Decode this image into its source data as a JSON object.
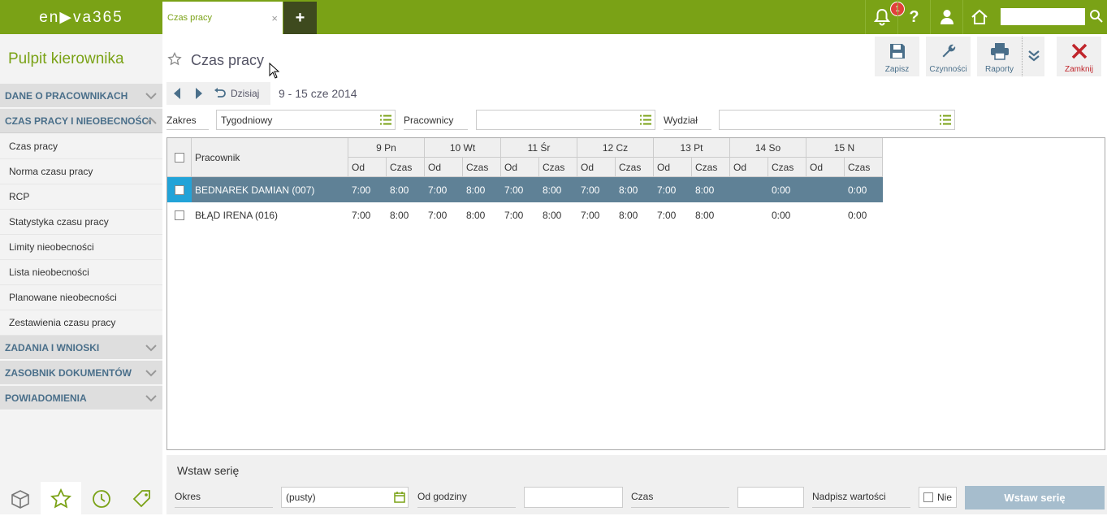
{
  "app": {
    "logo_text": "en▶va365",
    "brand_color": "#7aa216"
  },
  "tabs": [
    {
      "label": "Czas pracy",
      "close": "×"
    }
  ],
  "add_tab_label": "+",
  "notifications": {
    "count": "1"
  },
  "top_search": {
    "value": ""
  },
  "sidebar": {
    "title": "Pulpit kierownika",
    "sections": [
      {
        "label": "DANE O PRACOWNIKACH",
        "expanded": false
      },
      {
        "label": "CZAS PRACY I NIEOBECNOŚCI",
        "expanded": true
      },
      {
        "label": "ZADANIA I WNIOSKI",
        "expanded": false
      },
      {
        "label": "ZASOBNIK DOKUMENTÓW",
        "expanded": false
      },
      {
        "label": "POWIADOMIENIA",
        "expanded": false
      }
    ],
    "items": [
      "Czas pracy",
      "Norma czasu pracy",
      "RCP",
      "Statystyka czasu pracy",
      "Limity nieobecności",
      "Lista nieobecności",
      "Planowane nieobecności",
      "Zestawienia czasu pracy"
    ]
  },
  "page": {
    "title": "Czas pracy"
  },
  "toolbar": {
    "save": "Zapisz",
    "actions": "Czynności",
    "reports": "Raporty",
    "close": "Zamknij"
  },
  "nav": {
    "today": "Dzisiaj",
    "period": "9 - 15 cze 2014"
  },
  "filters": {
    "zakres_label": "Zakres",
    "zakres_value": "Tygodniowy",
    "pracownicy_label": "Pracownicy",
    "pracownicy_value": "",
    "wydzial_label": "Wydział",
    "wydzial_value": ""
  },
  "grid": {
    "employee_header": "Pracownik",
    "days": [
      "9 Pn",
      "10 Wt",
      "11 Śr",
      "12 Cz",
      "13 Pt",
      "14 So",
      "15 N"
    ],
    "subheaders": {
      "od": "Od",
      "czas": "Czas"
    },
    "rows": [
      {
        "name": "BEDNAREK DAMIAN (007)",
        "selected": true,
        "values": [
          "7:00",
          "8:00",
          "7:00",
          "8:00",
          "7:00",
          "8:00",
          "7:00",
          "8:00",
          "7:00",
          "8:00",
          "",
          "0:00",
          "",
          "0:00"
        ]
      },
      {
        "name": "BŁĄD IRENA (016)",
        "selected": false,
        "values": [
          "7:00",
          "8:00",
          "7:00",
          "8:00",
          "7:00",
          "8:00",
          "7:00",
          "8:00",
          "7:00",
          "8:00",
          "",
          "0:00",
          "",
          "0:00"
        ]
      }
    ]
  },
  "bottom": {
    "title": "Wstaw serię",
    "okres_label": "Okres",
    "okres_value": "(pusty)",
    "od_godziny_label": "Od godziny",
    "od_godziny_value": "",
    "czas_label": "Czas",
    "czas_value": "",
    "nadpisz_label": "Nadpisz wartości",
    "nadpisz_value": "Nie",
    "button": "Wstaw serię"
  }
}
